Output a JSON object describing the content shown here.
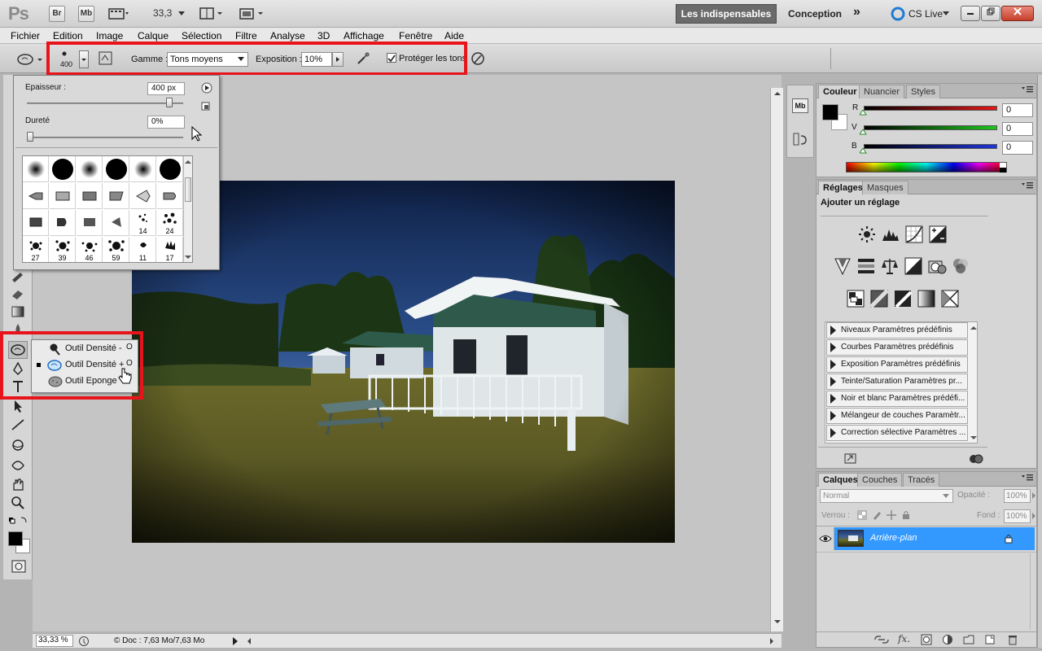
{
  "appbar": {
    "logo": "Ps",
    "br": "Br",
    "mb": "Mb",
    "zoom": "33,3",
    "workspace_active": "Les indispensables",
    "workspace_other": "Conception",
    "more": "»",
    "cs_live": "CS Live"
  },
  "menu": [
    "Fichier",
    "Edition",
    "Image",
    "Calque",
    "Sélection",
    "Filtre",
    "Analyse",
    "3D",
    "Affichage",
    "Fenêtre",
    "Aide"
  ],
  "options": {
    "brush_size": "400",
    "gamme_label": "Gamme :",
    "gamme_value": "Tons moyens",
    "exposition_label": "Exposition :",
    "exposition_value": "10%",
    "protect_label": "Protéger les tons",
    "protect_checked": true
  },
  "brush_popup": {
    "epaisseur_label": "Epaisseur :",
    "epaisseur_value": "400 px",
    "epaisseur_pos": 0.93,
    "durete_label": "Dureté",
    "durete_value": "0%",
    "durete_pos": 0.0,
    "row4_labels": [
      "14",
      "24"
    ],
    "row5_labels": [
      "27",
      "39",
      "46",
      "59",
      "11",
      "17"
    ]
  },
  "flyout": {
    "items": [
      {
        "label": "Outil Densité -",
        "key": "O",
        "selected": false
      },
      {
        "label": "Outil Densité +",
        "key": "O",
        "selected": true
      },
      {
        "label": "Outil Eponge",
        "key": "",
        "selected": false
      }
    ]
  },
  "color_panel": {
    "tabs": [
      "Couleur",
      "Nuancier",
      "Styles"
    ],
    "channels": [
      {
        "label": "R",
        "value": "0",
        "color": "#e02020"
      },
      {
        "label": "V",
        "value": "0",
        "color": "#20c020"
      },
      {
        "label": "B",
        "value": "0",
        "color": "#2030d0"
      }
    ]
  },
  "adjust_panel": {
    "tabs": [
      "Réglages",
      "Masques"
    ],
    "heading": "Ajouter un réglage",
    "presets": [
      "Niveaux Paramètres prédéfinis",
      "Courbes Paramètres prédéfinis",
      "Exposition Paramètres prédéfinis",
      "Teinte/Saturation Paramètres pr...",
      "Noir et blanc Paramètres prédéfi...",
      "Mélangeur de couches Paramètr...",
      "Correction sélective Paramètres ..."
    ]
  },
  "layers_panel": {
    "tabs": [
      "Calques",
      "Couches",
      "Tracés"
    ],
    "blend_mode": "Normal",
    "opacity_label": "Opacité :",
    "opacity_value": "100%",
    "lock_label": "Verrou :",
    "fill_label": "Fond :",
    "fill_value": "100%",
    "layer_name": "Arrière-plan",
    "accent": "#3399ff"
  },
  "status": {
    "zoom": "33,33 %",
    "doc": "© Doc : 7,63 Mo/7,63 Mo"
  }
}
